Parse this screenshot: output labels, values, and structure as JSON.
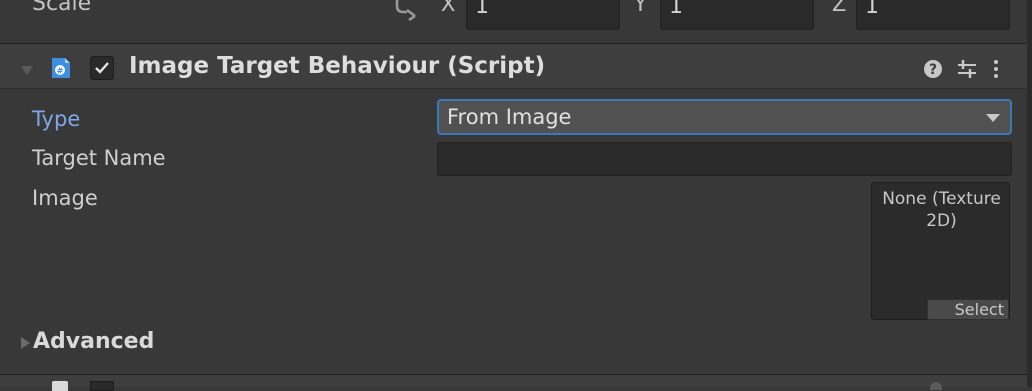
{
  "transform_row": {
    "label": "Scale",
    "x_label": "X",
    "x_value": "1",
    "y_label": "Y",
    "y_value": "1",
    "z_label": "Z",
    "z_value": "1"
  },
  "component": {
    "title": "Image Target Behaviour (Script)",
    "enabled": true,
    "script_icon": "csharp-script-icon",
    "help_icon": "help-icon",
    "preset_icon": "preset-icon",
    "more_icon": "kebab-menu-icon"
  },
  "properties": {
    "type_label": "Type",
    "type_value": "From Image",
    "target_name_label": "Target Name",
    "target_name_value": "",
    "image_label": "Image",
    "texture_value": "None (Texture 2D)",
    "texture_select_label": "Select"
  },
  "advanced": {
    "label": "Advanced"
  },
  "colors": {
    "background": "#383838",
    "header": "#3e3e3e",
    "accent": "#3a79bb",
    "type_label": "#7da7e5"
  }
}
